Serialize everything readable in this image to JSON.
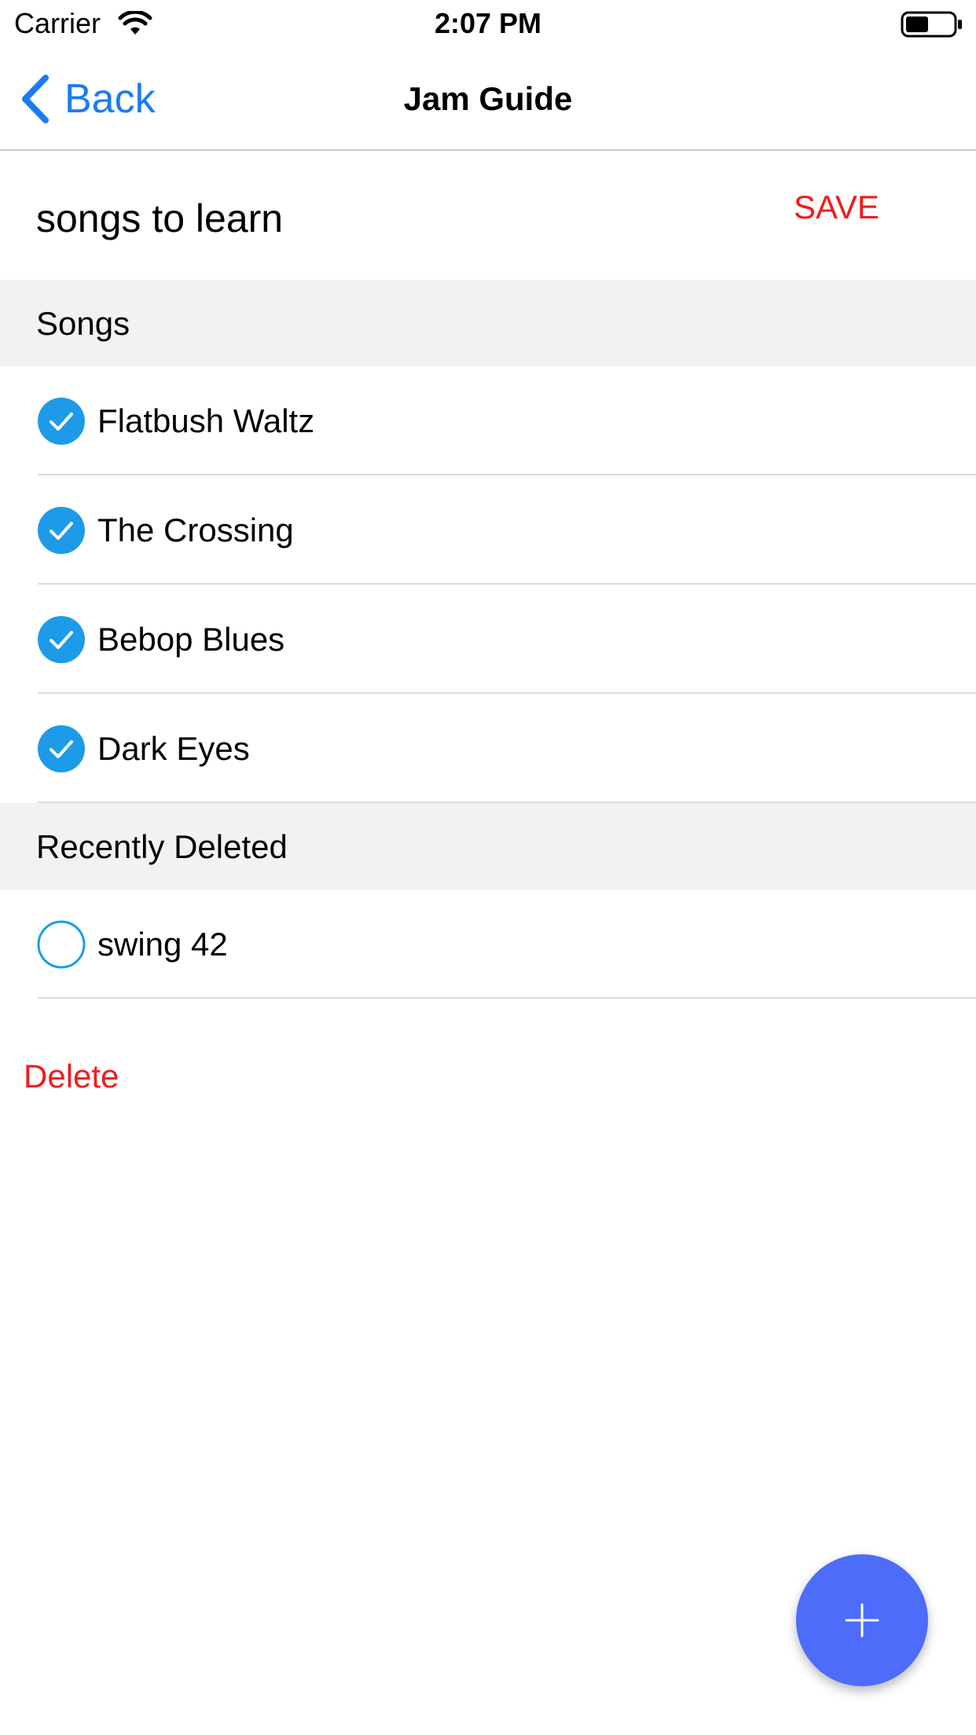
{
  "status_bar": {
    "carrier": "Carrier",
    "time": "2:07 PM"
  },
  "nav": {
    "back_label": "Back",
    "title": "Jam Guide",
    "back_icon": "chevron-left-icon"
  },
  "list": {
    "name": "songs to learn",
    "save_label": "SAVE"
  },
  "sections": {
    "songs": {
      "title": "Songs",
      "items": [
        {
          "label": "Flatbush Waltz",
          "checked": true
        },
        {
          "label": "The Crossing",
          "checked": true
        },
        {
          "label": "Bebop Blues",
          "checked": true
        },
        {
          "label": "Dark Eyes",
          "checked": true
        }
      ]
    },
    "recently_deleted": {
      "title": "Recently Deleted",
      "items": [
        {
          "label": "swing 42",
          "checked": false
        }
      ]
    }
  },
  "actions": {
    "delete_label": "Delete",
    "add_icon": "plus-icon"
  },
  "colors": {
    "accent_blue": "#1a7cf2",
    "check_blue": "#1e9be8",
    "destructive_red": "#f21b1b",
    "fab_blue": "#4d6cfa",
    "section_bg": "#f2f2f2"
  }
}
